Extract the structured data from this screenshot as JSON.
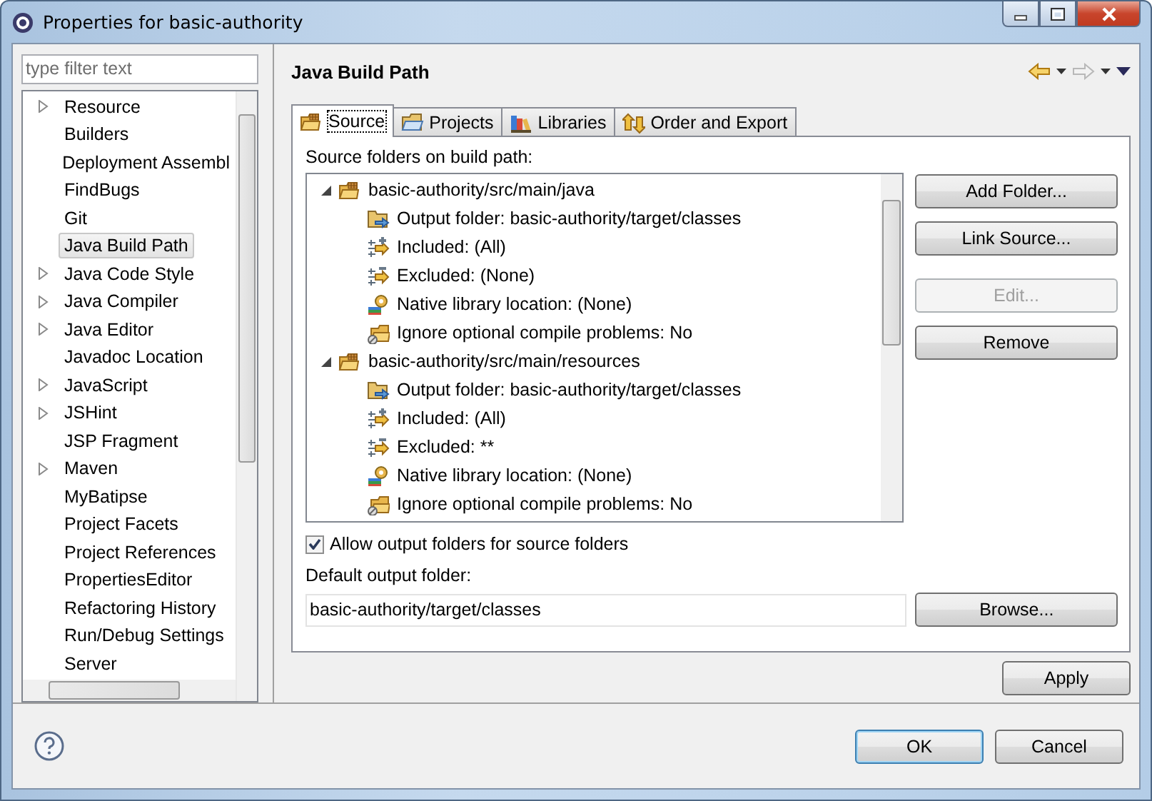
{
  "window": {
    "title": "Properties for basic-authority"
  },
  "filter": {
    "placeholder": "type filter text"
  },
  "sidebar": {
    "items": [
      {
        "label": "Resource",
        "has_children": true,
        "selected": false
      },
      {
        "label": "Builders",
        "has_children": false,
        "selected": false
      },
      {
        "label": "Deployment Assembl",
        "has_children": false,
        "selected": false
      },
      {
        "label": "FindBugs",
        "has_children": false,
        "selected": false
      },
      {
        "label": "Git",
        "has_children": false,
        "selected": false
      },
      {
        "label": "Java Build Path",
        "has_children": false,
        "selected": true
      },
      {
        "label": "Java Code Style",
        "has_children": true,
        "selected": false
      },
      {
        "label": "Java Compiler",
        "has_children": true,
        "selected": false
      },
      {
        "label": "Java Editor",
        "has_children": true,
        "selected": false
      },
      {
        "label": "Javadoc Location",
        "has_children": false,
        "selected": false
      },
      {
        "label": "JavaScript",
        "has_children": true,
        "selected": false
      },
      {
        "label": "JSHint",
        "has_children": true,
        "selected": false
      },
      {
        "label": "JSP Fragment",
        "has_children": false,
        "selected": false
      },
      {
        "label": "Maven",
        "has_children": true,
        "selected": false
      },
      {
        "label": "MyBatipse",
        "has_children": false,
        "selected": false
      },
      {
        "label": "Project Facets",
        "has_children": false,
        "selected": false
      },
      {
        "label": "Project References",
        "has_children": false,
        "selected": false
      },
      {
        "label": "PropertiesEditor",
        "has_children": false,
        "selected": false
      },
      {
        "label": "Refactoring History",
        "has_children": false,
        "selected": false
      },
      {
        "label": "Run/Debug Settings",
        "has_children": false,
        "selected": false
      },
      {
        "label": "Server",
        "has_children": false,
        "selected": false
      }
    ]
  },
  "page": {
    "title": "Java Build Path"
  },
  "tabs": [
    {
      "label": "Source",
      "kind": "source",
      "selected": true
    },
    {
      "label": "Projects",
      "kind": "projects",
      "selected": false
    },
    {
      "label": "Libraries",
      "kind": "libraries",
      "selected": false
    },
    {
      "label": "Order and Export",
      "kind": "order",
      "selected": false
    }
  ],
  "source_tab": {
    "label": "Source folders on build path:",
    "folders": [
      {
        "path": "basic-authority/src/main/java",
        "expanded": true,
        "children": [
          {
            "kind": "output",
            "text": "Output folder: basic-authority/target/classes"
          },
          {
            "kind": "included",
            "text": "Included: (All)"
          },
          {
            "kind": "excluded",
            "text": "Excluded: (None)"
          },
          {
            "kind": "native",
            "text": "Native library location: (None)"
          },
          {
            "kind": "ignore",
            "text": "Ignore optional compile problems: No"
          }
        ]
      },
      {
        "path": "basic-authority/src/main/resources",
        "expanded": true,
        "children": [
          {
            "kind": "output",
            "text": "Output folder: basic-authority/target/classes"
          },
          {
            "kind": "included",
            "text": "Included: (All)"
          },
          {
            "kind": "excluded",
            "text": "Excluded: **"
          },
          {
            "kind": "native",
            "text": "Native library location: (None)"
          },
          {
            "kind": "ignore",
            "text": "Ignore optional compile problems: No"
          }
        ]
      }
    ],
    "buttons": [
      {
        "label": "Add Folder...",
        "disabled": false
      },
      {
        "label": "Link Source...",
        "disabled": false
      },
      {
        "label": "Edit...",
        "disabled": true
      },
      {
        "label": "Remove",
        "disabled": false
      }
    ],
    "allow_output_folders": {
      "label": "Allow output folders for source folders",
      "checked": true
    },
    "default_output": {
      "label": "Default output folder:",
      "value": "basic-authority/target/classes"
    },
    "browse_button": "Browse..."
  },
  "apply_button": "Apply",
  "footer": {
    "buttons": [
      {
        "label": "OK",
        "default": true
      },
      {
        "label": "Cancel",
        "default": false
      }
    ]
  }
}
